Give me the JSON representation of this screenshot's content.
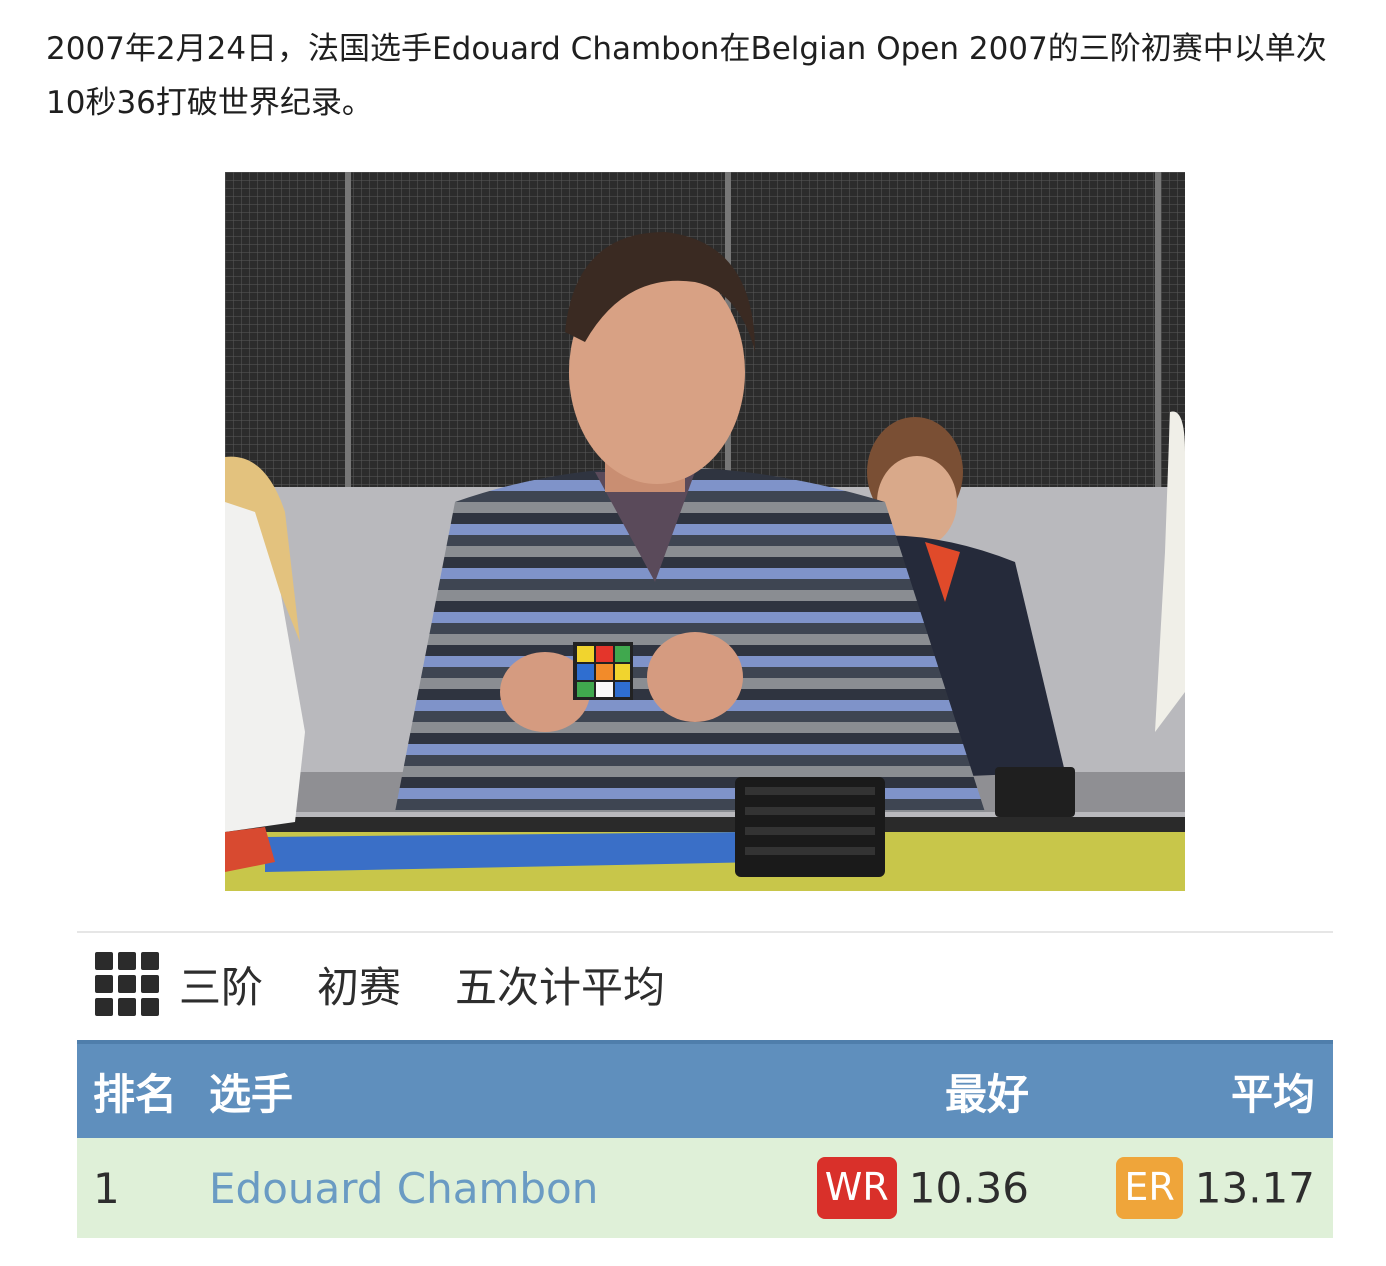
{
  "article": {
    "paragraph": "2007年2月24日，法国选手Edouard Chambon在Belgian Open 2007的三阶初赛中以单次10秒36打破世界纪录。"
  },
  "photo": {
    "description_icon": "photo-of-cuber-solving-cube"
  },
  "event": {
    "icon": "3x3-grid-icon",
    "name": "三阶",
    "round": "初赛",
    "format": "五次计平均"
  },
  "table": {
    "headers": {
      "rank": "排名",
      "competitor": "选手",
      "best": "最好",
      "average": "平均"
    },
    "rows": [
      {
        "rank": "1",
        "name": "Edouard Chambon",
        "best_badge": "WR",
        "best": "10.36",
        "avg_badge": "ER",
        "average": "13.17"
      }
    ]
  },
  "colors": {
    "header_bg": "#5f8fbd",
    "row_bg": "#dff0d8",
    "link": "#6a9bc3",
    "wr_badge": "#d9302a",
    "er_badge": "#efa53a"
  }
}
